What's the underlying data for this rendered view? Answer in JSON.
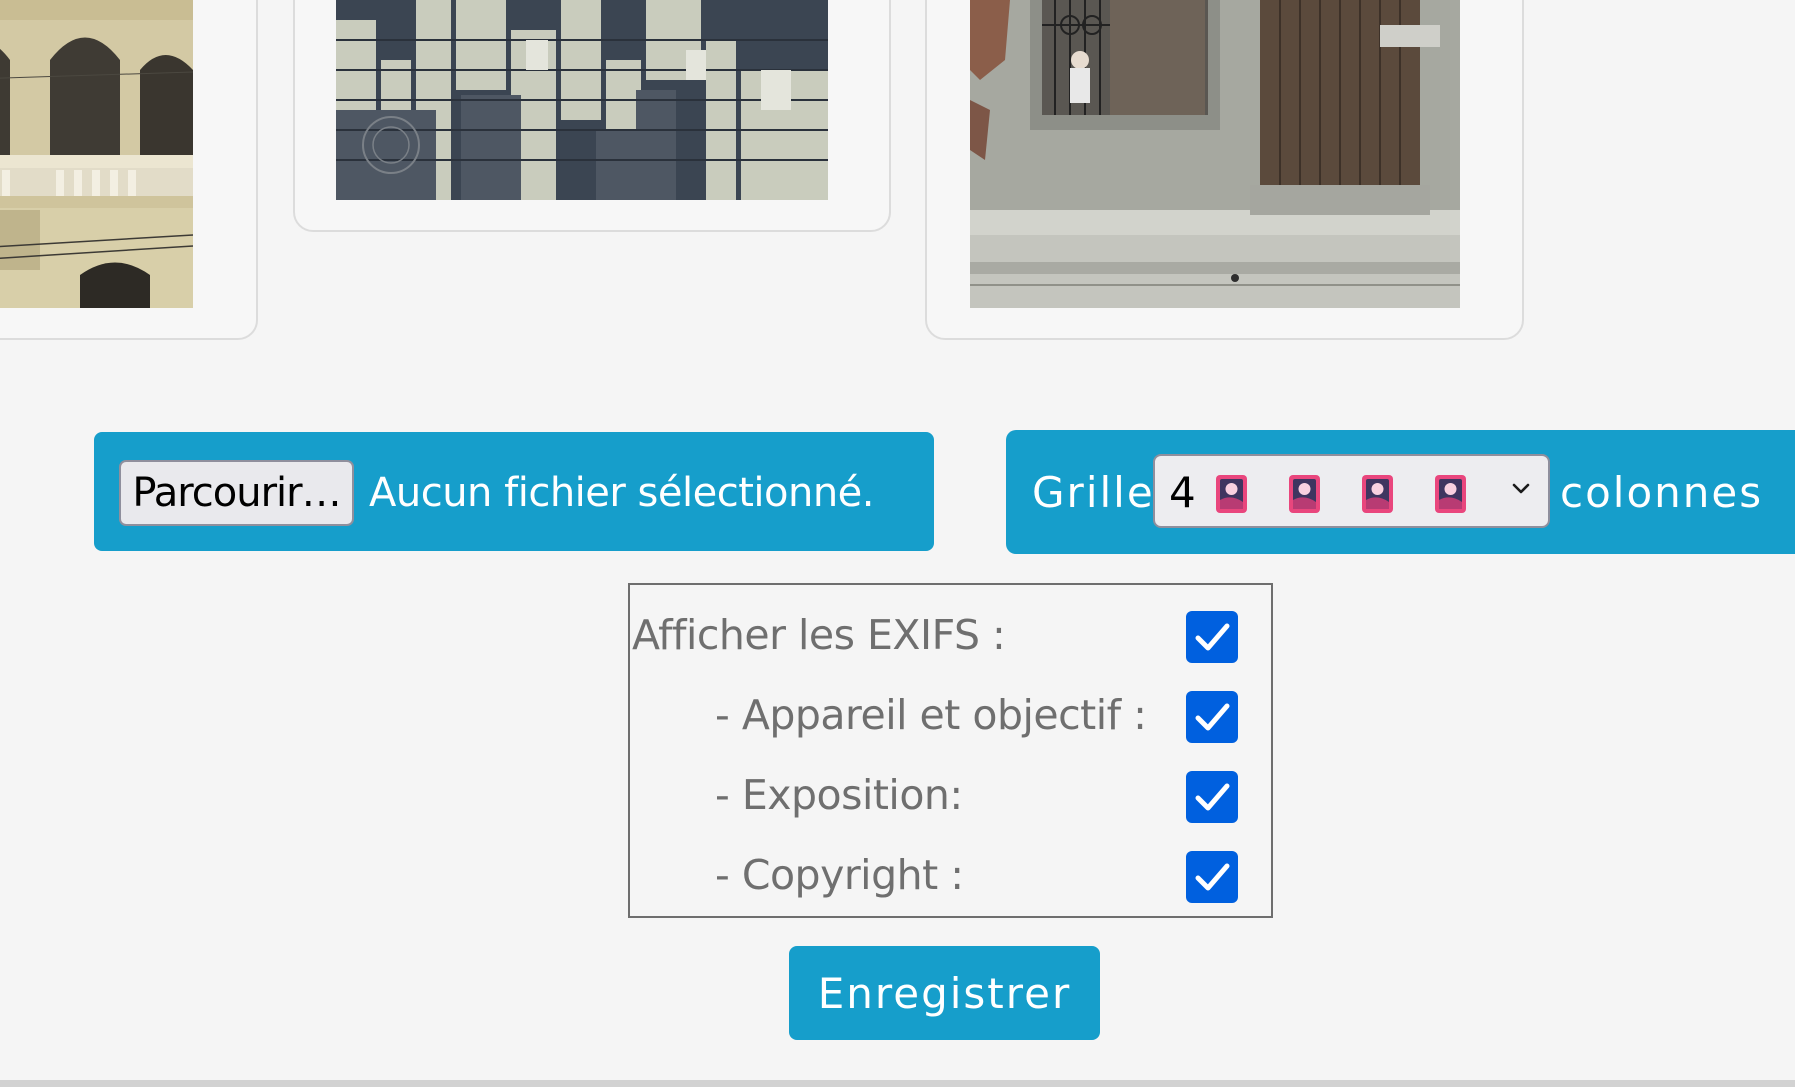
{
  "file_upload": {
    "button_label": "Parcourir…",
    "status_text": "Aucun fichier sélectionné."
  },
  "grid": {
    "label": "Grille",
    "selected_value": "4",
    "selected_icons": [
      "picture-icon",
      "picture-icon",
      "picture-icon",
      "picture-icon"
    ],
    "suffix": "colonnes"
  },
  "exif": {
    "items": [
      {
        "label": "Afficher les EXIFS :",
        "checked": true
      },
      {
        "label": "- Appareil et objectif :",
        "checked": true
      },
      {
        "label": "- Exposition:",
        "checked": true
      },
      {
        "label": "- Copyright :",
        "checked": true
      }
    ]
  },
  "actions": {
    "save_label": "Enregistrer"
  },
  "colors": {
    "page_background": "#f5f5f5",
    "accent": "#169ecb",
    "checkbox": "#0060df",
    "label_text": "#6f6f6f"
  },
  "photos": [
    {
      "icon": "photo-building-arches"
    },
    {
      "icon": "photo-city-skyline"
    },
    {
      "icon": "photo-window-and-door"
    }
  ]
}
